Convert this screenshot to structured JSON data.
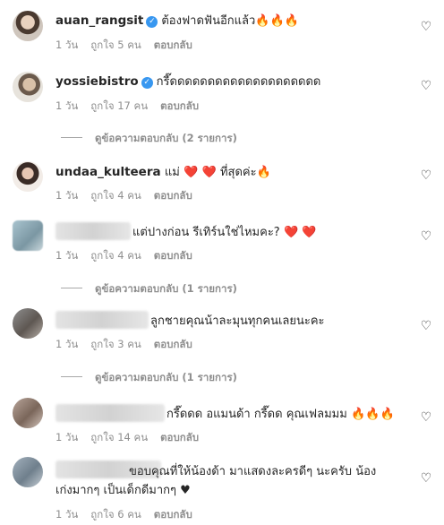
{
  "comments": [
    {
      "username": "auan_rangsit",
      "verified": true,
      "text": "ต้องฟาดฟันอีกแล้ว",
      "emoji": "🔥🔥🔥",
      "time": "1 วัน",
      "likes": "ถูกใจ 5 คน",
      "reply_label": "ตอบกลับ"
    },
    {
      "username": "yossiebistro",
      "verified": true,
      "text": "กรี๊ดดดดดดดดดดดดดดดดดดดด",
      "time": "1 วัน",
      "likes": "ถูกใจ 17 คน",
      "reply_label": "ตอบกลับ",
      "view_replies": "ดูข้อความตอบกลับ (2 รายการ)"
    },
    {
      "username": "undaa_kulteera",
      "verified": false,
      "text_pre": "แม่",
      "hearts": "❤️ ❤️",
      "text_post": "ที่สุดค่ะ",
      "emoji": "🔥",
      "time": "1 วัน",
      "likes": "ถูกใจ 4 คน",
      "reply_label": "ตอบกลับ"
    },
    {
      "username": "",
      "text": "แต่ปางก่อน รีเทิร์นใช่ไหมคะ?",
      "hearts": "❤️ ❤️",
      "time": "1 วัน",
      "likes": "ถูกใจ 4 คน",
      "reply_label": "ตอบกลับ",
      "view_replies": "ดูข้อความตอบกลับ (1 รายการ)"
    },
    {
      "username": "",
      "text": "ลูกชายคุณน้าละมุนทุกคนเลยนะคะ",
      "time": "1 วัน",
      "likes": "ถูกใจ 3 คน",
      "reply_label": "ตอบกลับ",
      "view_replies": "ดูข้อความตอบกลับ (1 รายการ)"
    },
    {
      "username": "",
      "text": "กรี๊ดดด อแมนด้า กรี๊ดด คุณเฟลมมม",
      "emoji": "🔥🔥🔥",
      "time": "1 วัน",
      "likes": "ถูกใจ 14 คน",
      "reply_label": "ตอบกลับ"
    },
    {
      "username": "",
      "text_line1": "ขอบคุณที่ให้น้องด้า มาแสดงละครดีๆ นะครับ น้อง",
      "text_line2": "เก่งมากๆ เป็นเด็กดีมากๆ ♥",
      "time": "1 วัน",
      "likes": "ถูกใจ 6 คน",
      "reply_label": "ตอบกลับ"
    }
  ],
  "icons": {
    "like": "heart-outline-icon",
    "verified": "verified-badge-icon"
  },
  "colors": {
    "text": "#262626",
    "secondary": "#8e8e8e",
    "verified": "#3897f0"
  }
}
